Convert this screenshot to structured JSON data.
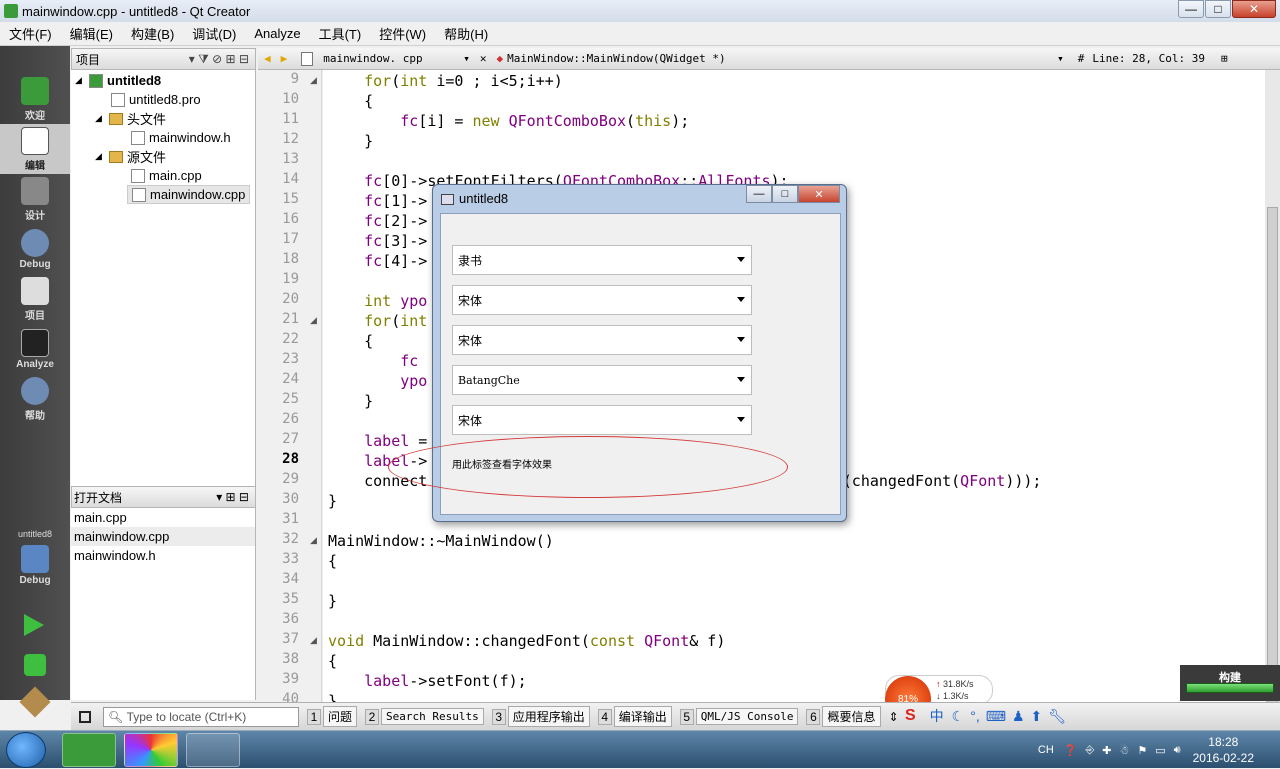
{
  "window": {
    "title": "mainwindow.cpp - untitled8 - Qt Creator",
    "min": "—",
    "max": "□",
    "close": "✕"
  },
  "menu": [
    "文件(F)",
    "编辑(E)",
    "构建(B)",
    "调试(D)",
    "Analyze",
    "工具(T)",
    "控件(W)",
    "帮助(H)"
  ],
  "modes": [
    {
      "label": "欢迎",
      "icon": "qt-logo-icon"
    },
    {
      "label": "编辑",
      "icon": "edit-document-icon"
    },
    {
      "label": "设计",
      "icon": "design-icon"
    },
    {
      "label": "Debug",
      "icon": "debug-icon"
    },
    {
      "label": "项目",
      "icon": "project-icon"
    },
    {
      "label": "Analyze",
      "icon": "analyze-icon"
    },
    {
      "label": "帮助",
      "icon": "help-icon"
    }
  ],
  "target": {
    "project": "untitled8",
    "mode": "Debug"
  },
  "projects": {
    "header": "项目",
    "tree": [
      {
        "label": "untitled8",
        "kind": "project"
      },
      {
        "label": "untitled8.pro",
        "kind": "file"
      },
      {
        "label": "头文件",
        "kind": "folder"
      },
      {
        "label": "mainwindow.h",
        "kind": "file"
      },
      {
        "label": "源文件",
        "kind": "folder"
      },
      {
        "label": "main.cpp",
        "kind": "file"
      },
      {
        "label": "mainwindow.cpp",
        "kind": "file"
      }
    ]
  },
  "opendocs": {
    "header": "打开文档",
    "items": [
      "main.cpp",
      "mainwindow.cpp",
      "mainwindow.h"
    ]
  },
  "editor": {
    "file": "mainwindow. cpp",
    "symbol": "MainWindow::MainWindow(QWidget *)",
    "position": "Line: 28, Col: 39",
    "hash": "#",
    "current_line": "28",
    "lines": [
      {
        "n": "9",
        "t": "    for(int i=0 ; i<5;i++)"
      },
      {
        "n": "10",
        "t": "    {"
      },
      {
        "n": "11",
        "t": "        fc[i] = new QFontComboBox(this);"
      },
      {
        "n": "12",
        "t": "    }"
      },
      {
        "n": "13",
        "t": ""
      },
      {
        "n": "14",
        "t": "    fc[0]->setFontFilters(QFontComboBox::AllFonts);"
      },
      {
        "n": "15",
        "t": "    fc[1]->                                     ts);"
      },
      {
        "n": "16",
        "t": "    fc[2]->                                     Fonts);"
      },
      {
        "n": "17",
        "t": "    fc[3]->                                     onts);"
      },
      {
        "n": "18",
        "t": "    fc[4]->                                     lFonts);"
      },
      {
        "n": "19",
        "t": ""
      },
      {
        "n": "20",
        "t": "    int ypo"
      },
      {
        "n": "21",
        "t": "    for(int"
      },
      {
        "n": "22",
        "t": "    {"
      },
      {
        "n": "23",
        "t": "        fc"
      },
      {
        "n": "24",
        "t": "        ypo"
      },
      {
        "n": "25",
        "t": "    }"
      },
      {
        "n": "26",
        "t": ""
      },
      {
        "n": "27",
        "t": "    label ="
      },
      {
        "n": "28",
        "t": "    label->"
      },
      {
        "n": "29",
        "t": "    connect                                     this,SLOT(changedFont(QFont)));"
      },
      {
        "n": "30",
        "t": "}"
      },
      {
        "n": "31",
        "t": ""
      },
      {
        "n": "32",
        "t": "MainWindow::~MainWindow()"
      },
      {
        "n": "33",
        "t": "{"
      },
      {
        "n": "34",
        "t": ""
      },
      {
        "n": "35",
        "t": "}"
      },
      {
        "n": "36",
        "t": ""
      },
      {
        "n": "37",
        "t": "void MainWindow::changedFont(const QFont& f)"
      },
      {
        "n": "38",
        "t": "{"
      },
      {
        "n": "39",
        "t": "    label->setFont(f);"
      },
      {
        "n": "40",
        "t": "}"
      }
    ]
  },
  "dialog": {
    "title": "untitled8",
    "combos": [
      "隶书",
      "宋体",
      "宋体",
      "BatangChe",
      "宋体"
    ],
    "label": "用此标签查看字体效果"
  },
  "bottom": {
    "locate_placeholder": "Type to locate (Ctrl+K)",
    "tabs": [
      {
        "n": "1",
        "t": "问题"
      },
      {
        "n": "2",
        "t": "Search Results"
      },
      {
        "n": "3",
        "t": "应用程序输出"
      },
      {
        "n": "4",
        "t": "编译输出"
      },
      {
        "n": "5",
        "t": "QML/JS Console"
      },
      {
        "n": "6",
        "t": "概要信息"
      }
    ]
  },
  "build": {
    "label": "构建",
    "progress": 1.0
  },
  "netmeter": {
    "percent": "81%",
    "up": "31.8K/s",
    "down": "1.3K/s"
  },
  "ime": {
    "brand": "S",
    "mode": "中"
  },
  "tray": {
    "lang": "CH",
    "time": "18:28",
    "date": "2016-02-22"
  },
  "colors": {
    "keyword": "#808000",
    "type": "#800080",
    "accent": "#3b9b3b"
  }
}
